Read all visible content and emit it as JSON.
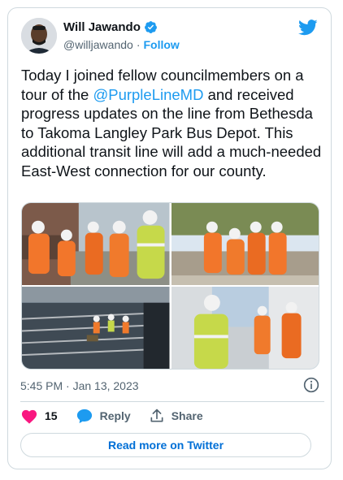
{
  "author": {
    "name": "Will Jawando",
    "handle": "@willjawando",
    "separator": "·",
    "follow_label": "Follow"
  },
  "tweet": {
    "text_before": "Today I joined fellow councilmembers on a tour of the ",
    "mention": "@PurpleLineMD",
    "text_after": " and received progress updates on the line from Bethesda to Takoma Langley Park Bus Depot. This additional transit line will add a much-needed East-West connection for our county.",
    "timestamp": "5:45 PM · Jan 13, 2023"
  },
  "actions": {
    "like_count": "15",
    "reply_label": "Reply",
    "share_label": "Share"
  },
  "read_more_label": "Read more on Twitter",
  "colors": {
    "accent": "#1d9bf0",
    "like": "#f91880",
    "text": "#0f1419",
    "muted": "#536471",
    "border": "#cfd9de"
  },
  "icons": [
    "twitter-bird-icon",
    "verified-badge-icon",
    "info-icon",
    "heart-icon",
    "reply-bubble-icon",
    "share-icon"
  ]
}
